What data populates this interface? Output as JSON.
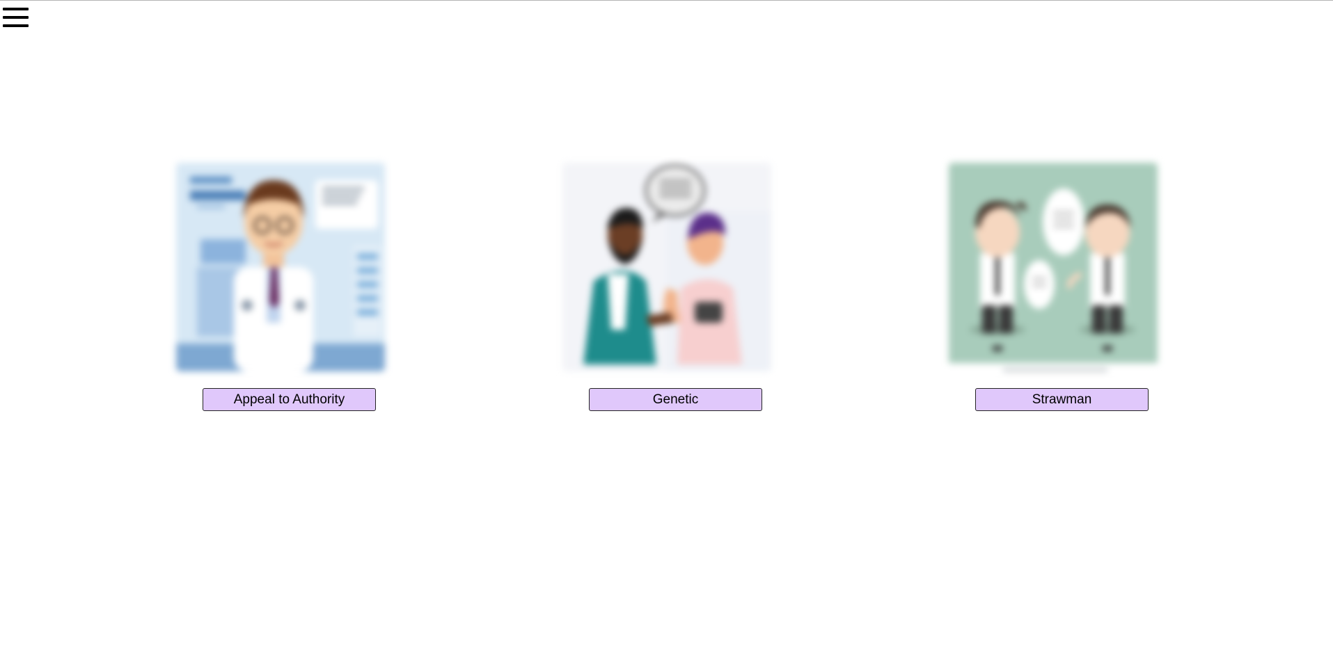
{
  "header": {
    "menu_icon": "hamburger-menu-icon"
  },
  "cards": [
    {
      "label": "Appeal to Authority",
      "image": "doctor-illustration",
      "image_bg": "#c9dff0"
    },
    {
      "label": "Genetic",
      "image": "two-people-talking-illustration",
      "image_bg": "#f3f4f8"
    },
    {
      "label": "Strawman",
      "image": "two-businessmen-speech-bubbles-illustration",
      "image_bg": "#a8ccbb"
    }
  ],
  "colors": {
    "button_bg": "#e0c8fb",
    "button_border": "#222222"
  }
}
